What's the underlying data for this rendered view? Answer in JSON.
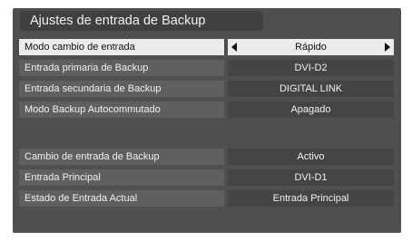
{
  "title": "Ajustes de entrada de Backup",
  "group1": [
    {
      "label": "Modo cambio de entrada",
      "value": "Rápido"
    },
    {
      "label": "Entrada primaria de Backup",
      "value": "DVI-D2"
    },
    {
      "label": "Entrada secundaria de Backup",
      "value": "DIGITAL LINK"
    },
    {
      "label": "Modo Backup Autocommutado",
      "value": "Apagado"
    }
  ],
  "group2": [
    {
      "label": "Cambio de entrada de Backup",
      "value": "Activo"
    },
    {
      "label": "Entrada Principal",
      "value": "DVI-D1"
    },
    {
      "label": "Estado de Entrada Actual",
      "value": "Entrada Principal"
    }
  ],
  "icons": {
    "left": "arrow-left-icon",
    "right": "arrow-right-icon"
  },
  "colors": {
    "panel": "#4f4f4f",
    "label_bg": "#5f5f5f",
    "value_bg": "#444444",
    "selected_bg": "#ececec"
  }
}
